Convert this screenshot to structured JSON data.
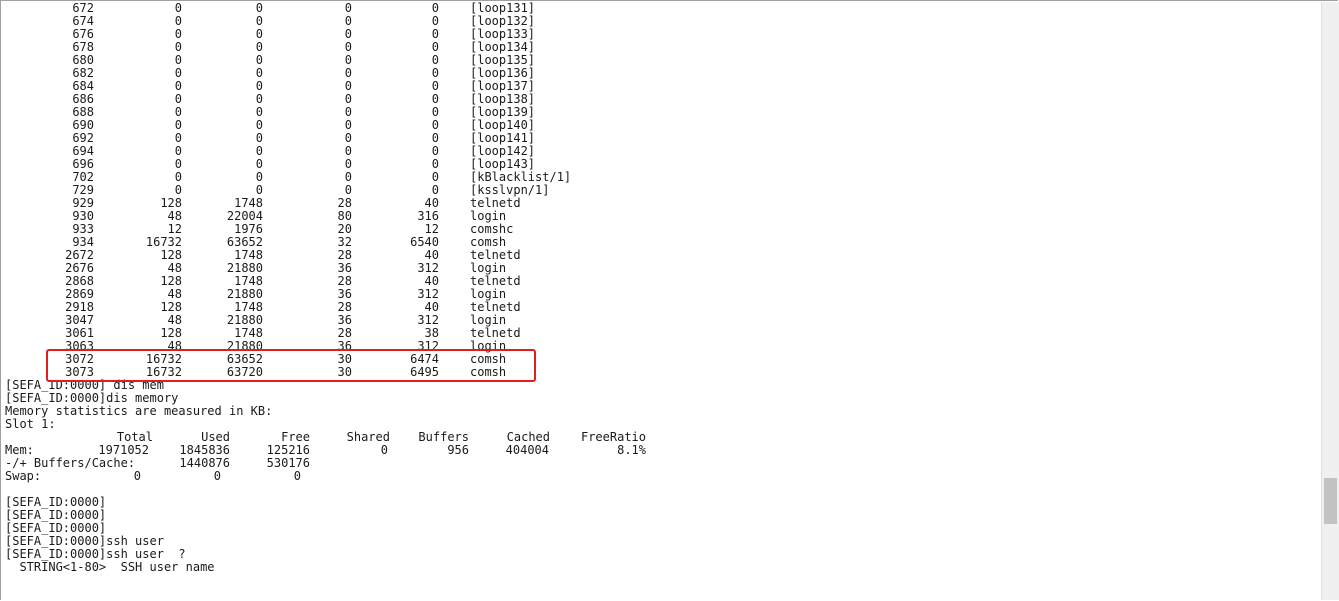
{
  "process_rows": [
    {
      "job": "672",
      "c1": "0",
      "c2": "0",
      "c3": "0",
      "c4": "0",
      "name": "[loop131]"
    },
    {
      "job": "674",
      "c1": "0",
      "c2": "0",
      "c3": "0",
      "c4": "0",
      "name": "[loop132]"
    },
    {
      "job": "676",
      "c1": "0",
      "c2": "0",
      "c3": "0",
      "c4": "0",
      "name": "[loop133]"
    },
    {
      "job": "678",
      "c1": "0",
      "c2": "0",
      "c3": "0",
      "c4": "0",
      "name": "[loop134]"
    },
    {
      "job": "680",
      "c1": "0",
      "c2": "0",
      "c3": "0",
      "c4": "0",
      "name": "[loop135]"
    },
    {
      "job": "682",
      "c1": "0",
      "c2": "0",
      "c3": "0",
      "c4": "0",
      "name": "[loop136]"
    },
    {
      "job": "684",
      "c1": "0",
      "c2": "0",
      "c3": "0",
      "c4": "0",
      "name": "[loop137]"
    },
    {
      "job": "686",
      "c1": "0",
      "c2": "0",
      "c3": "0",
      "c4": "0",
      "name": "[loop138]"
    },
    {
      "job": "688",
      "c1": "0",
      "c2": "0",
      "c3": "0",
      "c4": "0",
      "name": "[loop139]"
    },
    {
      "job": "690",
      "c1": "0",
      "c2": "0",
      "c3": "0",
      "c4": "0",
      "name": "[loop140]"
    },
    {
      "job": "692",
      "c1": "0",
      "c2": "0",
      "c3": "0",
      "c4": "0",
      "name": "[loop141]"
    },
    {
      "job": "694",
      "c1": "0",
      "c2": "0",
      "c3": "0",
      "c4": "0",
      "name": "[loop142]"
    },
    {
      "job": "696",
      "c1": "0",
      "c2": "0",
      "c3": "0",
      "c4": "0",
      "name": "[loop143]"
    },
    {
      "job": "702",
      "c1": "0",
      "c2": "0",
      "c3": "0",
      "c4": "0",
      "name": "[kBlacklist/1]"
    },
    {
      "job": "729",
      "c1": "0",
      "c2": "0",
      "c3": "0",
      "c4": "0",
      "name": "[ksslvpn/1]"
    },
    {
      "job": "929",
      "c1": "128",
      "c2": "1748",
      "c3": "28",
      "c4": "40",
      "name": "telnetd"
    },
    {
      "job": "930",
      "c1": "48",
      "c2": "22004",
      "c3": "80",
      "c4": "316",
      "name": "login"
    },
    {
      "job": "933",
      "c1": "12",
      "c2": "1976",
      "c3": "20",
      "c4": "12",
      "name": "comshc"
    },
    {
      "job": "934",
      "c1": "16732",
      "c2": "63652",
      "c3": "32",
      "c4": "6540",
      "name": "comsh"
    },
    {
      "job": "2672",
      "c1": "128",
      "c2": "1748",
      "c3": "28",
      "c4": "40",
      "name": "telnetd"
    },
    {
      "job": "2676",
      "c1": "48",
      "c2": "21880",
      "c3": "36",
      "c4": "312",
      "name": "login"
    },
    {
      "job": "2868",
      "c1": "128",
      "c2": "1748",
      "c3": "28",
      "c4": "40",
      "name": "telnetd"
    },
    {
      "job": "2869",
      "c1": "48",
      "c2": "21880",
      "c3": "36",
      "c4": "312",
      "name": "login"
    },
    {
      "job": "2918",
      "c1": "128",
      "c2": "1748",
      "c3": "28",
      "c4": "40",
      "name": "telnetd"
    },
    {
      "job": "3047",
      "c1": "48",
      "c2": "21880",
      "c3": "36",
      "c4": "312",
      "name": "login"
    },
    {
      "job": "3061",
      "c1": "128",
      "c2": "1748",
      "c3": "28",
      "c4": "38",
      "name": "telnetd"
    },
    {
      "job": "3063",
      "c1": "48",
      "c2": "21880",
      "c3": "36",
      "c4": "312",
      "name": "login"
    },
    {
      "job": "3072",
      "c1": "16732",
      "c2": "63652",
      "c3": "30",
      "c4": "6474",
      "name": "comsh"
    },
    {
      "job": "3073",
      "c1": "16732",
      "c2": "63720",
      "c3": "30",
      "c4": "6495",
      "name": "comsh"
    }
  ],
  "console_lines_a": [
    "[SEFA_ID:0000] dis mem",
    "[SEFA_ID:0000]dis memory",
    "Memory statistics are measured in KB:",
    "Slot 1:"
  ],
  "memory_table": {
    "headers": [
      "Total",
      "Used",
      "Free",
      "Shared",
      "Buffers",
      "Cached",
      "FreeRatio"
    ],
    "mem_row": {
      "label": "Mem:",
      "values": [
        "1971052",
        "1845836",
        "125216",
        "0",
        "956",
        "404004",
        "8.1%"
      ]
    },
    "buffers_row": {
      "label": "-/+ Buffers/Cache:",
      "values": [
        "1440876",
        "530176"
      ]
    },
    "swap_row": {
      "label": "Swap:",
      "values": [
        "0",
        "0",
        "0"
      ]
    }
  },
  "console_lines_b": [
    "[SEFA_ID:0000]",
    "[SEFA_ID:0000]",
    "[SEFA_ID:0000]",
    "[SEFA_ID:0000]ssh user",
    "[SEFA_ID:0000]ssh user  ?",
    "  STRING<1-80>  SSH user name"
  ],
  "colors": {
    "highlight": "#e21d1d",
    "text": "#1a1a1a",
    "background": "#ffffff"
  }
}
